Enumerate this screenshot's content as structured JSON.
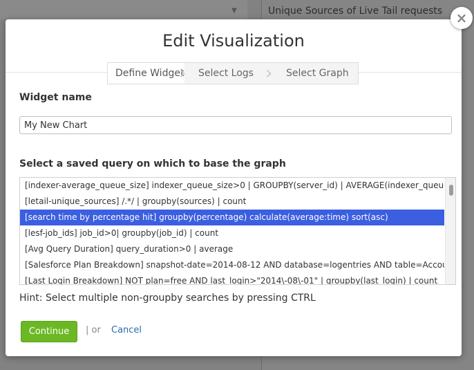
{
  "background": {
    "panel_title": "Unique Sources of Live Tail requests"
  },
  "modal": {
    "title": "Edit Visualization",
    "close_glyph": "×",
    "steps": [
      {
        "label": "Define Widget",
        "active": true
      },
      {
        "label": "Select Logs",
        "active": false
      },
      {
        "label": "Select Graph",
        "active": false
      }
    ],
    "widget_name_label": "Widget name",
    "widget_name_value": "My New Chart",
    "query_label": "Select a saved query on which to base the graph",
    "queries": [
      "[indexer-average_queue_size] indexer_queue_size>0 | GROUPBY(server_id) | AVERAGE(indexer_queue_size)",
      "[letail-unique_sources] /.*/ | groupby(sources) | count",
      "[search time by percentage hit] groupby(percentage) calculate(average:time) sort(asc)",
      "[lesf-job_ids] job_id>0| groupby(job_id) | count",
      "[Avg Query Duration] query_duration>0 | average",
      "[Salesforce Plan Breakdown] snapshot-date=2014-08-12 AND database=logentries AND table=Account | groupby(plan) | count",
      "[Last Login Breakdown] NOT plan=free AND last_login>\"2014\\-08\\-01\" | groupby(last_login) | count"
    ],
    "selected_query_index": 2,
    "hint": "Hint: Select multiple non-groupby searches by pressing CTRL",
    "continue_label": "Continue",
    "or_text": "| or",
    "cancel_label": "Cancel"
  },
  "colors": {
    "accent_green": "#6cb824",
    "selection_blue": "#3b5fe0",
    "link_blue": "#2b6cb0"
  },
  "icons": {
    "close": "close-icon",
    "step_separator": "chevron-right-icon",
    "background_toggle": "chevron-down-icon"
  }
}
